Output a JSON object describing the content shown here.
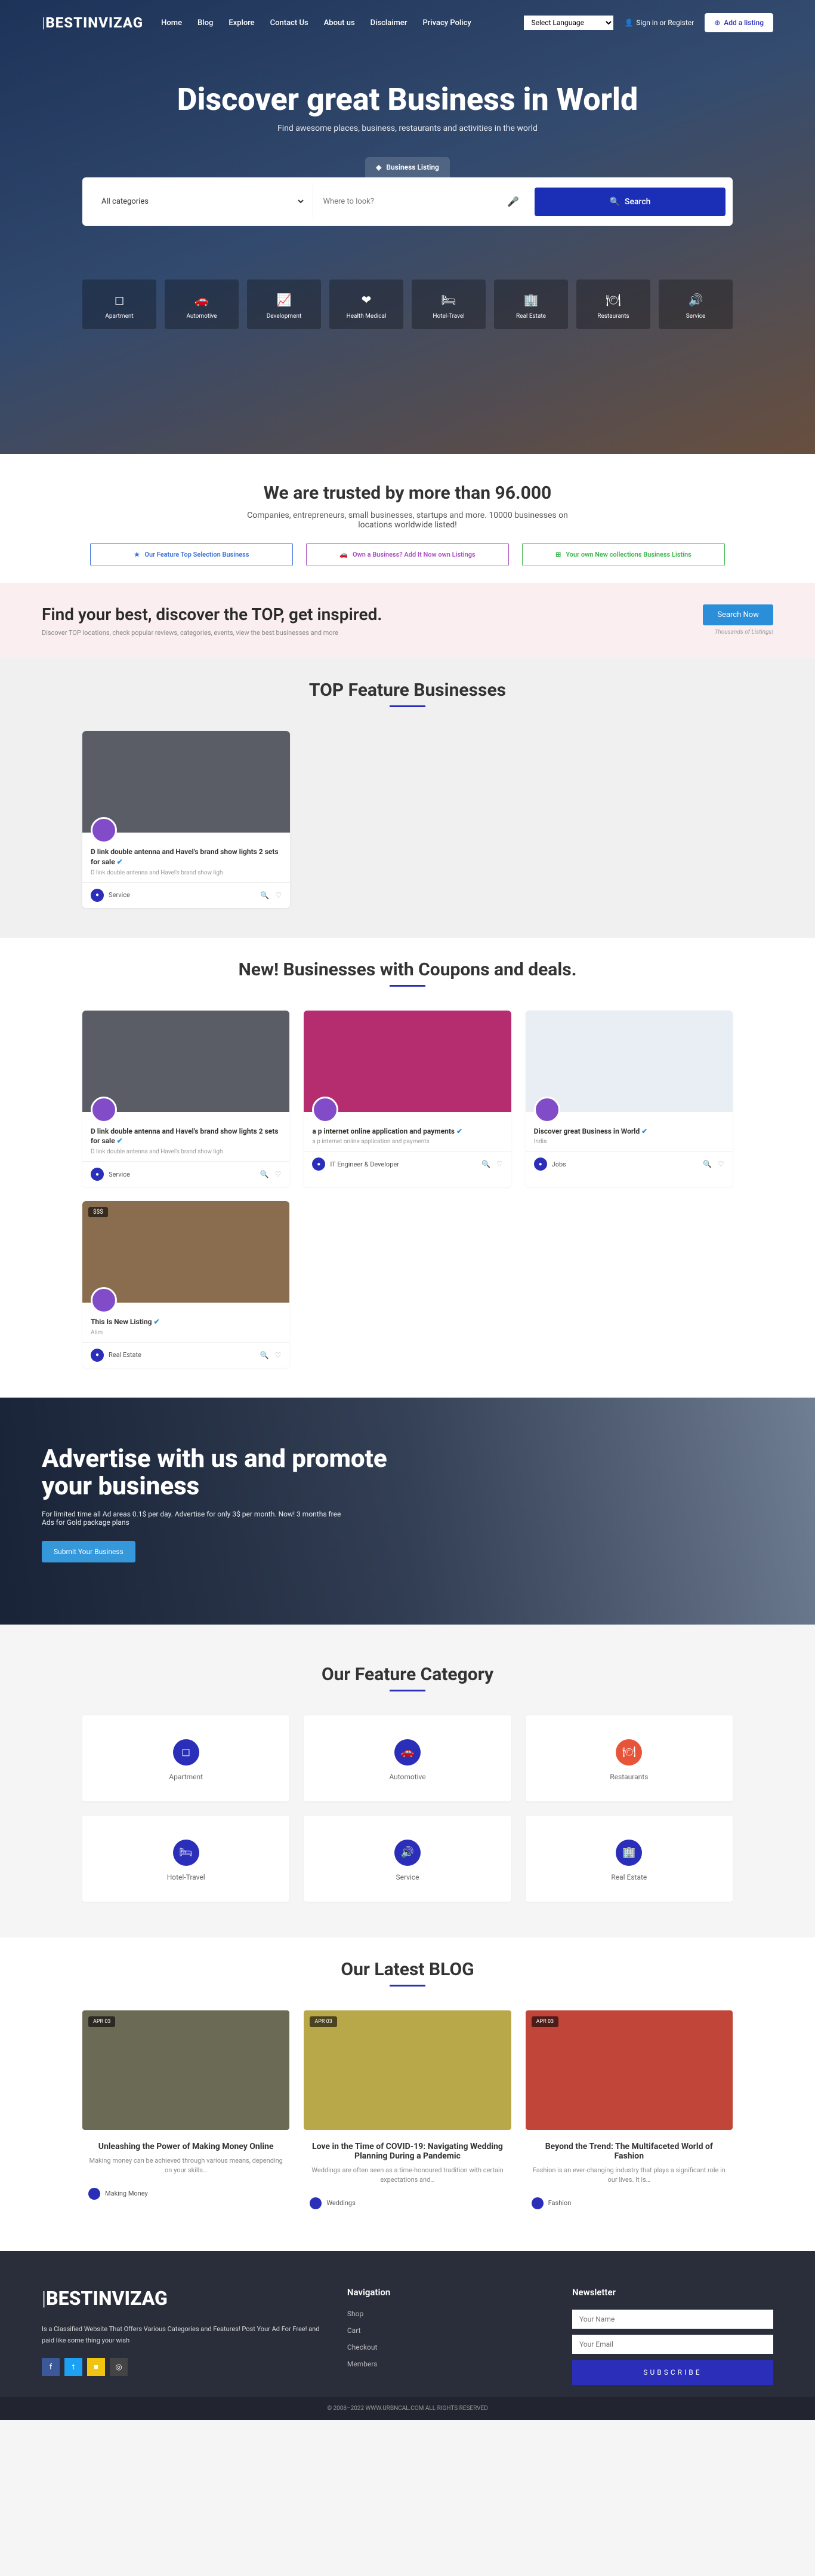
{
  "site": {
    "logo": "BESTINVIZAG"
  },
  "nav": [
    "Home",
    "Blog",
    "Explore",
    "Contact Us",
    "About us",
    "Disclaimer",
    "Privacy Policy"
  ],
  "lang_placeholder": "Select Language",
  "signin": "Sign in  or Register",
  "add_listing": "Add a listing",
  "hero": {
    "title": "Discover great Business in World",
    "subtitle": "Find awesome places, business, restaurants and activities in the world",
    "tab": "Business Listing",
    "cat_label": "All categories",
    "loc_placeholder": "Where to look?",
    "search_btn": "Search"
  },
  "hero_cats": [
    {
      "icon": "◻",
      "label": "Apartment"
    },
    {
      "icon": "🚗",
      "label": "Automotive"
    },
    {
      "icon": "📈",
      "label": "Development"
    },
    {
      "icon": "❤",
      "label": "Health Medical"
    },
    {
      "icon": "🛏",
      "label": "Hotel-Travel"
    },
    {
      "icon": "🏢",
      "label": "Real Estate"
    },
    {
      "icon": "🍽",
      "label": "Restaurants"
    },
    {
      "icon": "🔊",
      "label": "Service"
    }
  ],
  "trust": {
    "title": "We are trusted by more than 96.000",
    "desc": "Companies, entrepreneurs, small businesses, startups and more. 10000 businesses on locations worldwide listed!",
    "boxes": [
      "Our Feature Top Selection Business",
      "Own a Business? Add It Now own Listings",
      "Your own New collections Business Listins"
    ]
  },
  "find": {
    "title": "Find your best, discover the TOP, get inspired.",
    "sub": "Discover TOP locations, check popular reviews, categories, events, view the best businesses and more",
    "btn": "Search Now",
    "note": "Thousands of Listings!"
  },
  "top_biz_hd": "TOP Feature Businesses",
  "top_biz": [
    {
      "title": "D link double antenna and Havel's brand show lights 2 sets for sale ",
      "desc": "D link double antenna and Havel's brand show ligh",
      "cat": "Service"
    }
  ],
  "coupons_hd": "New! Businesses with Coupons and deals.",
  "coupons": [
    {
      "title": "D link double antenna and Havel's brand show lights 2 sets for sale ",
      "desc": "D link double antenna and Havel's brand show ligh",
      "cat": "Service",
      "img": "#5a5d66"
    },
    {
      "title": "a p internet online application and payments",
      "desc": "a p internet online application and payments",
      "cat": "IT Engineer & Developer",
      "img": "#b52d6f"
    },
    {
      "title": "Discover great Business in World",
      "desc": "India",
      "cat": "Jobs",
      "img": "#e8eef3"
    },
    {
      "title": "This Is New Listing",
      "desc": "Alim",
      "cat": "Real Estate",
      "img": "#8a6d4e",
      "price": "$$$"
    }
  ],
  "adv": {
    "title": "Advertise with us and promote your business",
    "desc": "For limited time all Ad areas 0.1$ per day. Advertise for only 3$ per month. Now! 3 months free Ads for Gold package plans",
    "btn": "Submit Your Business"
  },
  "fc_hd": "Our Feature Category",
  "fc": [
    {
      "icon": "◻",
      "label": "Apartment",
      "red": false
    },
    {
      "icon": "🚗",
      "label": "Automotive",
      "red": false
    },
    {
      "icon": "🍽",
      "label": "Restaurants",
      "red": true
    },
    {
      "icon": "🛏",
      "label": "Hotel-Travel",
      "red": false
    },
    {
      "icon": "🔊",
      "label": "Service",
      "red": false
    },
    {
      "icon": "🏢",
      "label": "Real Estate",
      "red": false
    }
  ],
  "blog_hd": "Our Latest BLOG",
  "blog": [
    {
      "date": "APR  03",
      "title": "Unleashing the Power of Making Money Online",
      "desc": "Making money can be achieved through various means, depending on your skills…",
      "cat": "Making Money",
      "img": "#6b6a55"
    },
    {
      "date": "APR  03",
      "title": "Love in the Time of COVID-19: Navigating Wedding Planning During a Pandemic",
      "desc": "Weddings are often seen as a time-honoured tradition with certain expectations and…",
      "cat": "Weddings",
      "img": "#b8a84a"
    },
    {
      "date": "APR  03",
      "title": "Beyond the Trend: The Multifaceted World of Fashion",
      "desc": "Fashion is an ever-changing industry that plays a significant role in our lives. It is…",
      "cat": "Fashion",
      "img": "#c2453a"
    }
  ],
  "footer": {
    "about": "Is a Classified Website That Offers Various Categories and Features! Post Your Ad For Free! and paid like some thing your wish",
    "nav_hd": "Navigation",
    "nav": [
      "Shop",
      "Cart",
      "Checkout",
      "Members"
    ],
    "news_hd": "Newsletter",
    "name_ph": "Your Name",
    "email_ph": "Your Email",
    "sub": "SUBSCRIBE",
    "copy": "© 2008–2022 WWW.URBNCAL.COM ALL RIGHTS RESERVED"
  }
}
